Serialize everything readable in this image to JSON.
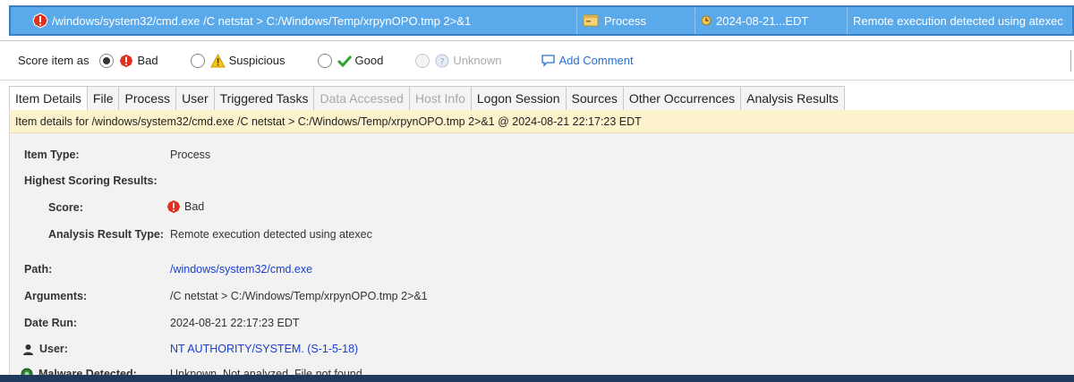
{
  "top_row": {
    "command": "/windows/system32/cmd.exe /C netstat > C:/Windows/Temp/xrpynOPO.tmp 2>&1",
    "type": "Process",
    "date": "2024-08-21...EDT",
    "description": "Remote execution detected using atexec"
  },
  "score_bar": {
    "label": "Score item as",
    "options": {
      "bad": "Bad",
      "suspicious": "Suspicious",
      "good": "Good",
      "unknown": "Unknown"
    },
    "selected": "Bad",
    "add_comment": "Add Comment"
  },
  "tabs": [
    "Item Details",
    "File",
    "Process",
    "User",
    "Triggered Tasks",
    "Data Accessed",
    "Host Info",
    "Logon Session",
    "Sources",
    "Other Occurrences",
    "Analysis Results"
  ],
  "active_tab": "Item Details",
  "disabled_tabs": [
    "Data Accessed",
    "Host Info"
  ],
  "details": {
    "banner": "Item details for /windows/system32/cmd.exe /C netstat > C:/Windows/Temp/xrpynOPO.tmp 2>&1 @ 2024-08-21 22:17:23 EDT",
    "item_type_label": "Item Type:",
    "item_type_value": "Process",
    "highest_label": "Highest Scoring Results:",
    "score_label": "Score:",
    "score_value": "Bad",
    "art_label": "Analysis Result Type:",
    "art_value": "Remote execution detected using atexec",
    "path_label": "Path:",
    "path_value": "/windows/system32/cmd.exe",
    "args_label": "Arguments:",
    "args_value": "/C netstat > C:/Windows/Temp/xrpynOPO.tmp 2>&1",
    "date_label": "Date Run:",
    "date_value": "2024-08-21 22:17:23 EDT",
    "user_label": "User:",
    "user_value": "NT AUTHORITY/SYSTEM. (S-1-5-18)",
    "malware_label": "Malware Detected:",
    "malware_value": "Unknown. Not analyzed. File not found."
  },
  "colors": {
    "selection": "#5aa9eb",
    "banner": "#fcf2cc",
    "link": "#1a3fd0",
    "bad": "#e0301e"
  }
}
